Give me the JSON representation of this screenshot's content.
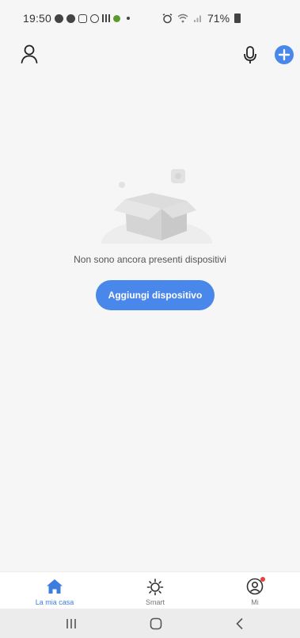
{
  "status_bar": {
    "time": "19:50",
    "battery": "71%"
  },
  "top_bar": {
    "left_icon": "user-icon",
    "right_icons": [
      "microphone-icon",
      "add-circle-icon"
    ],
    "accent_color": "#4a87ea"
  },
  "empty_state": {
    "illustration": "empty-box-icon",
    "message": "Non sono ancora presenti dispositivi",
    "button_label": "Aggiungi dispositivo"
  },
  "tabs": [
    {
      "label": "La mia casa",
      "icon": "home-icon",
      "active": true
    },
    {
      "label": "Smart",
      "icon": "sun-icon",
      "active": false
    },
    {
      "label": "Mi",
      "icon": "profile-icon",
      "active": false,
      "notification": true
    }
  ],
  "system_nav": {
    "buttons": [
      "recent-apps-icon",
      "home-nav-icon",
      "back-icon"
    ]
  }
}
